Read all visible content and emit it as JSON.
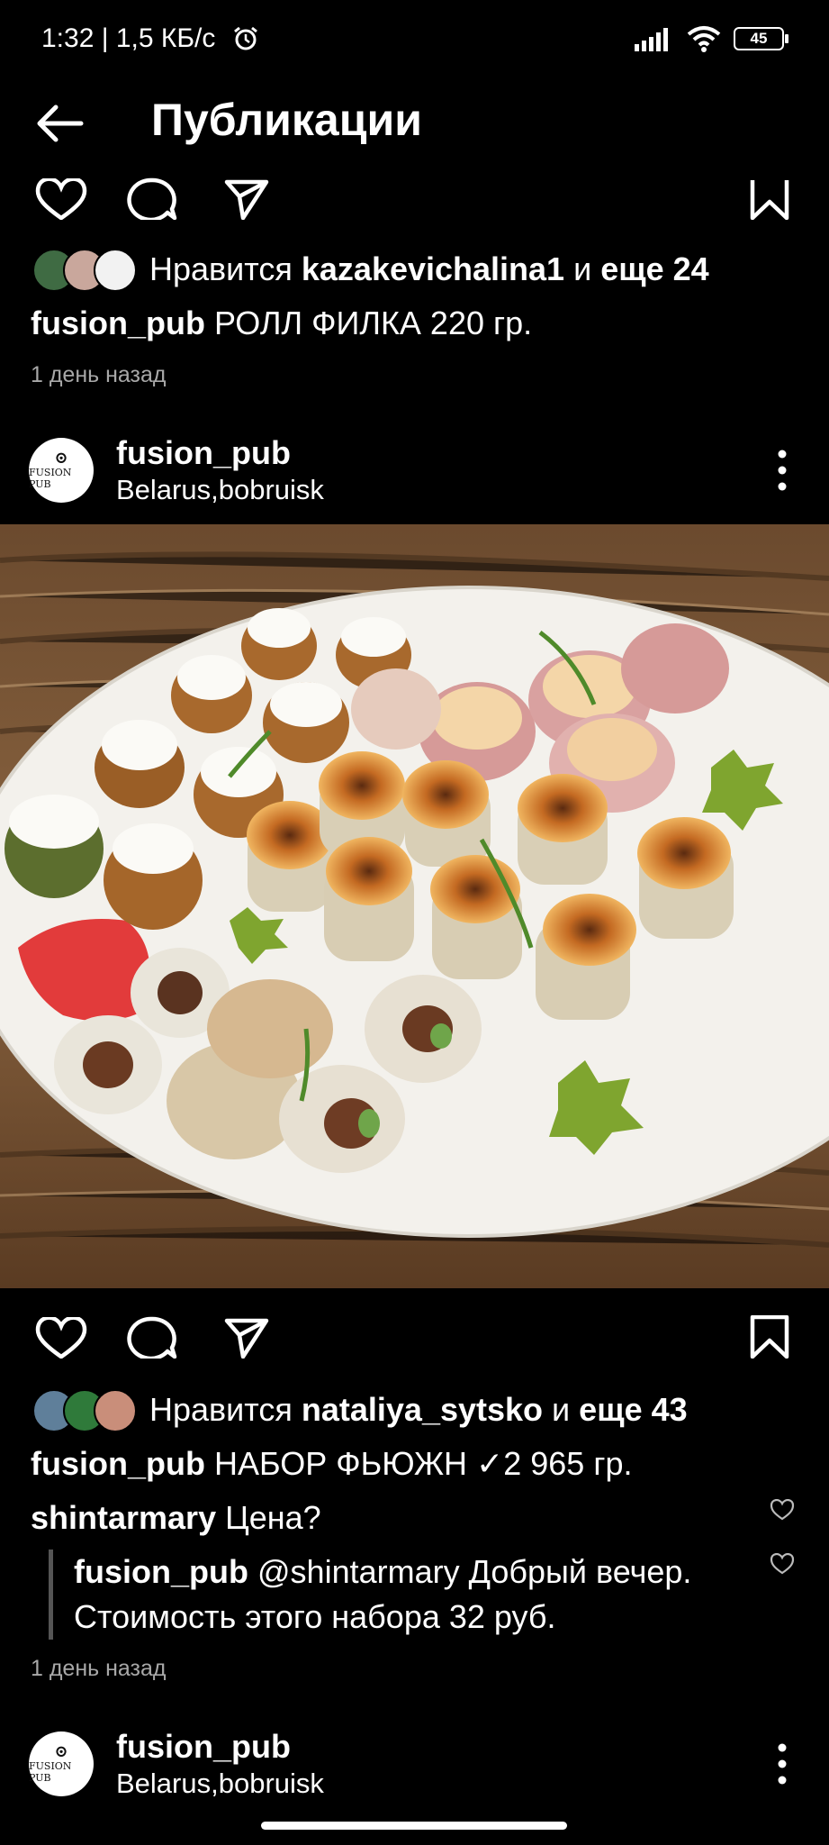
{
  "status_bar": {
    "time": "1:32 | 1,5 КБ/с",
    "battery": "45"
  },
  "header": {
    "title": "Публикации"
  },
  "post1": {
    "likes_prefix": "Нравится",
    "liked_by": "kazakevichalina1",
    "likes_and": "и",
    "likes_more": "еще 24",
    "caption_user": "fusion_pub",
    "caption_text": "РОЛЛ ФИЛКА 220 гр.",
    "time_ago": "1 день назад"
  },
  "post2": {
    "username": "fusion_pub",
    "location": "Belarus,bobruisk",
    "avatar_text": "FUSION PUB",
    "likes_prefix": "Нравится",
    "liked_by": "nataliya_sytsko",
    "likes_and": "и",
    "likes_more": "еще 43",
    "caption_user": "fusion_pub",
    "caption_text": "НАБОР ФЬЮЖН ✓2 965 гр.",
    "comments": [
      {
        "user": "shintarmary",
        "text": "Цена?"
      }
    ],
    "reply": {
      "user": "fusion_pub",
      "text_line1": "@shintarmary Добрый вечер.",
      "text_line2": "Стоимость этого набора 32 руб."
    },
    "time_ago": "1 день назад"
  },
  "post3": {
    "username": "fusion_pub",
    "location": "Belarus,bobruisk",
    "avatar_text": "FUSION PUB"
  },
  "colors": {
    "background": "#000000",
    "text": "#ffffff",
    "muted": "#a8a8a8"
  }
}
